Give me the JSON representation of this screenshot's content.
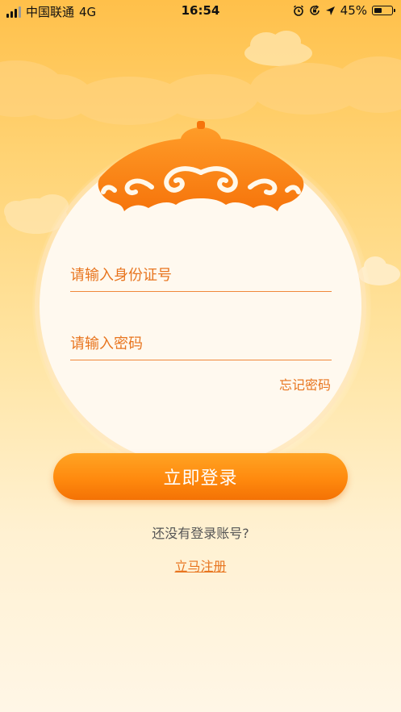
{
  "status_bar": {
    "carrier": "中国联通",
    "network": "4G",
    "time": "16:54",
    "battery": "45%",
    "icons": [
      "signal-icon",
      "alarm-icon",
      "rotation-lock-icon",
      "location-arrow-icon",
      "battery-icon"
    ]
  },
  "login": {
    "id_placeholder": "请输入身份证号",
    "password_placeholder": "请输入密码",
    "forgot_password": "忘记密码",
    "login_button": "立即登录",
    "no_account_text": "还没有登录账号?",
    "register_link": "立马注册"
  },
  "colors": {
    "accent": "#e8751f",
    "button_top": "#ffa424",
    "button_bottom": "#f47205",
    "background_top": "#ffc04a",
    "background_bottom": "#fff6e6"
  }
}
